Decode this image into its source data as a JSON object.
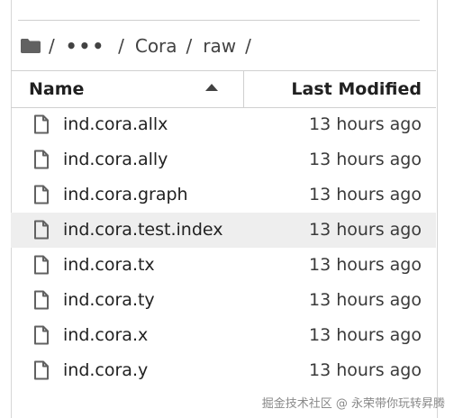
{
  "breadcrumb": {
    "folder_icon": "folder-icon",
    "separator": "/",
    "ellipsis": "•••",
    "segments": [
      "Cora",
      "raw"
    ]
  },
  "table": {
    "columns": {
      "name": "Name",
      "last_modified": "Last Modified"
    },
    "sort": "ascending-by-name",
    "highlight_color": "#eeeeee",
    "rows": [
      {
        "name": "ind.cora.allx",
        "modified": "13 hours ago",
        "icon": "file-icon",
        "highlighted": false
      },
      {
        "name": "ind.cora.ally",
        "modified": "13 hours ago",
        "icon": "file-icon",
        "highlighted": false
      },
      {
        "name": "ind.cora.graph",
        "modified": "13 hours ago",
        "icon": "file-icon",
        "highlighted": false
      },
      {
        "name": "ind.cora.test.index",
        "modified": "13 hours ago",
        "icon": "file-icon",
        "highlighted": true
      },
      {
        "name": "ind.cora.tx",
        "modified": "13 hours ago",
        "icon": "file-icon",
        "highlighted": false
      },
      {
        "name": "ind.cora.ty",
        "modified": "13 hours ago",
        "icon": "file-icon",
        "highlighted": false
      },
      {
        "name": "ind.cora.x",
        "modified": "13 hours ago",
        "icon": "file-icon",
        "highlighted": false
      },
      {
        "name": "ind.cora.y",
        "modified": "13 hours ago",
        "icon": "file-icon",
        "highlighted": false
      }
    ]
  },
  "watermark": "掘金技术社区 @ 永荣带你玩转昇腾"
}
